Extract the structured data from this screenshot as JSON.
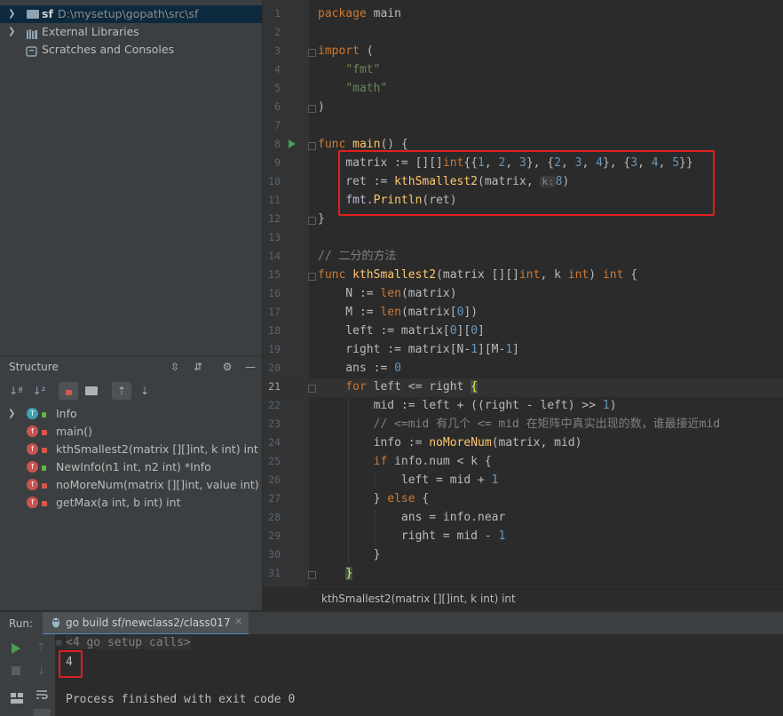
{
  "project_tree": {
    "root": {
      "name": "sf",
      "path": "D:\\mysetup\\gopath\\src\\sf"
    },
    "external_libraries": "External Libraries",
    "scratches": "Scratches and Consoles"
  },
  "structure": {
    "title": "Structure",
    "items": [
      {
        "badge": "T",
        "name": "Info",
        "color": "#40a0b0"
      },
      {
        "badge": "f",
        "name": "main()",
        "color": "#c75450"
      },
      {
        "badge": "f",
        "name": "kthSmallest2(matrix [][]int, k int) int",
        "color": "#c75450"
      },
      {
        "badge": "f",
        "name": "NewInfo(n1 int, n2 int) *Info",
        "color": "#c75450"
      },
      {
        "badge": "f",
        "name": "noMoreNum(matrix [][]int, value int) *Info",
        "color": "#c75450"
      },
      {
        "badge": "f",
        "name": "getMax(a int, b int) int",
        "color": "#c75450"
      }
    ]
  },
  "editor": {
    "line_numbers": [
      "1",
      "2",
      "3",
      "4",
      "5",
      "6",
      "7",
      "8",
      "9",
      "10",
      "11",
      "12",
      "13",
      "14",
      "15",
      "16",
      "17",
      "18",
      "19",
      "20",
      "21",
      "22",
      "23",
      "24",
      "25",
      "26",
      "27",
      "28",
      "29",
      "30",
      "31"
    ],
    "breadcrumb": "kthSmallest2(matrix [][]int, k int) int",
    "hint_label": "k:"
  },
  "run": {
    "label": "Run:",
    "tab": "go build sf/newclass2/class017",
    "setup_calls": "<4 go setup calls>",
    "output": "4",
    "finished": "Process finished with exit code 0"
  },
  "colors": {
    "highlight": "#e02020",
    "keyword": "#cc7832",
    "function": "#ffc66d",
    "string": "#6a8759",
    "number": "#6897bb"
  }
}
